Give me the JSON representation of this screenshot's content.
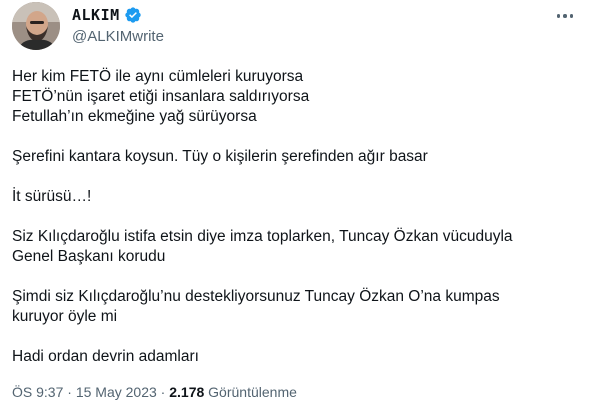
{
  "tweet": {
    "author": {
      "display_name": "ALKIM",
      "handle": "@ALKIMwrite",
      "verified_icon": "verified-badge-icon",
      "verified_color": "#1d9bf0"
    },
    "more_icon": "more-horizontal-icon",
    "paragraphs": [
      {
        "lines": [
          "Her kim FETÖ ile aynı cümleleri kuruyorsa",
          "FETÖ’nün işaret etiği insanlara saldırıyorsa",
          "Fetullah’ın ekmeğine yağ sürüyorsa"
        ]
      },
      {
        "lines": [
          "Şerefini kantara koysun. Tüy o kişilerin şerefinden ağır basar"
        ]
      },
      {
        "lines": [
          "İt sürüsü…!"
        ]
      },
      {
        "lines": [
          "Siz Kılıçdaroğlu istifa etsin diye imza toplarken, Tuncay Özkan vücuduyla",
          "Genel Başkanı korudu"
        ]
      },
      {
        "lines": [
          "Şimdi siz Kılıçdaroğlu’nu destekliyorsunuz Tuncay Özkan O’na kumpas",
          "kuruyor öyle mi"
        ]
      },
      {
        "lines": [
          "Hadi ordan devrin adamları"
        ]
      }
    ],
    "meta": {
      "time": "ÖS 9:37",
      "separator": " · ",
      "date": "15 May 2023",
      "views_count": "2.178",
      "views_label": "Görüntülenme"
    }
  }
}
